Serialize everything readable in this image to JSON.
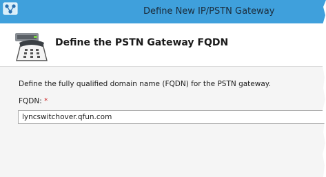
{
  "window": {
    "title": "Define New IP/PSTN Gateway"
  },
  "header": {
    "heading": "Define the PSTN Gateway FQDN"
  },
  "main": {
    "description": "Define the fully qualified domain name (FQDN) for the PSTN gateway.",
    "fqdn_label": "FQDN:",
    "required_marker": "*",
    "fqdn_value": "lyncswitchover.qfun.com"
  },
  "icons": {
    "app": "lync-topology-builder-icon",
    "header": "pstn-gateway-phone-icon"
  },
  "colors": {
    "titlebar": "#3fa0dc",
    "required_marker": "#cc2222"
  }
}
